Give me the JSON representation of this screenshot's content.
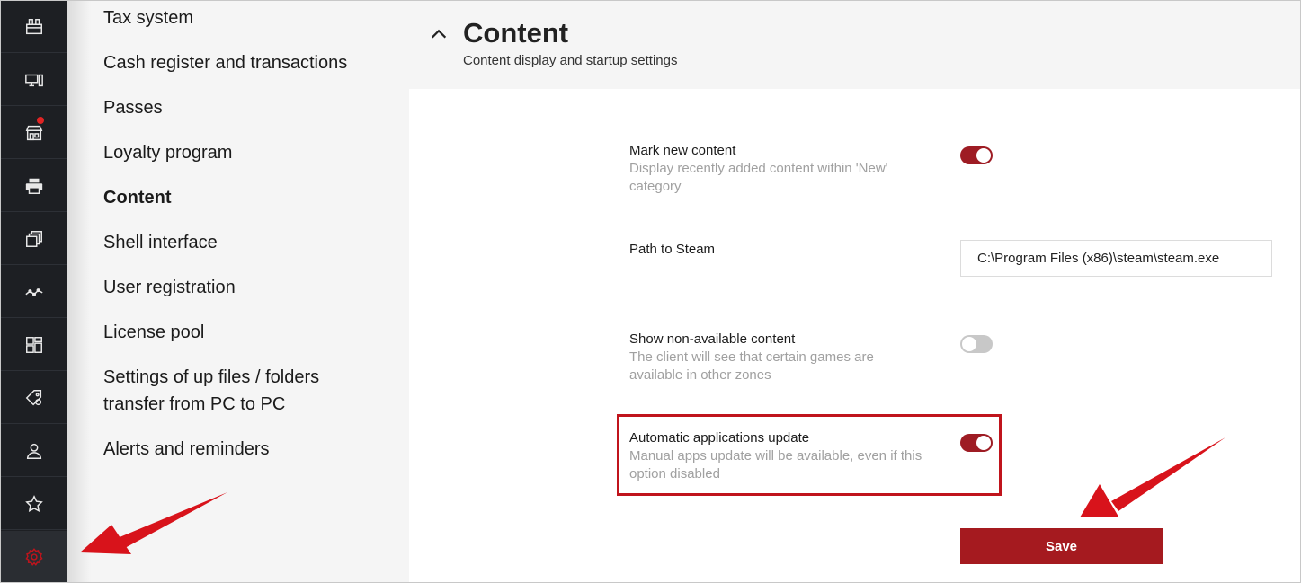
{
  "rail": {
    "items": [
      {
        "name": "clubs-icon"
      },
      {
        "name": "computers-icon"
      },
      {
        "name": "shop-icon",
        "badge": true
      },
      {
        "name": "printer-icon"
      },
      {
        "name": "layers-icon"
      },
      {
        "name": "analytics-icon"
      },
      {
        "name": "apps-grid-icon"
      },
      {
        "name": "tags-icon"
      },
      {
        "name": "users-icon"
      },
      {
        "name": "star-icon"
      },
      {
        "name": "settings-gear-icon",
        "active": true
      }
    ]
  },
  "menu": {
    "items": [
      {
        "label": "Tax system"
      },
      {
        "label": "Cash register and transactions"
      },
      {
        "label": "Passes"
      },
      {
        "label": "Loyalty program"
      },
      {
        "label": "Content",
        "active": true
      },
      {
        "label": "Shell interface"
      },
      {
        "label": "User registration"
      },
      {
        "label": "License pool"
      },
      {
        "label": "Settings of up files / folders transfer from PC to PC"
      },
      {
        "label": "Alerts and reminders"
      }
    ]
  },
  "panel": {
    "title": "Content",
    "subtitle": "Content display and startup settings",
    "settings": [
      {
        "label": "Mark new content",
        "description": "Display recently added content within 'New' category",
        "type": "toggle",
        "enabled": true
      },
      {
        "label": "Path to Steam",
        "type": "input",
        "value": "C:\\Program Files (x86)\\steam\\steam.exe"
      },
      {
        "label": "Show non-available content",
        "description": "The client will see that certain games are available in other zones",
        "type": "toggle",
        "enabled": false
      },
      {
        "label": "Automatic applications update",
        "description": "Manual apps update will be available, even if this option disabled",
        "type": "toggle",
        "enabled": true,
        "highlighted": true
      }
    ],
    "save_label": "Save"
  },
  "colors": {
    "accent": "#a51a1f",
    "highlight": "#c0141c",
    "rail_bg": "#1d1f23",
    "menu_bg": "#f5f5f5"
  }
}
